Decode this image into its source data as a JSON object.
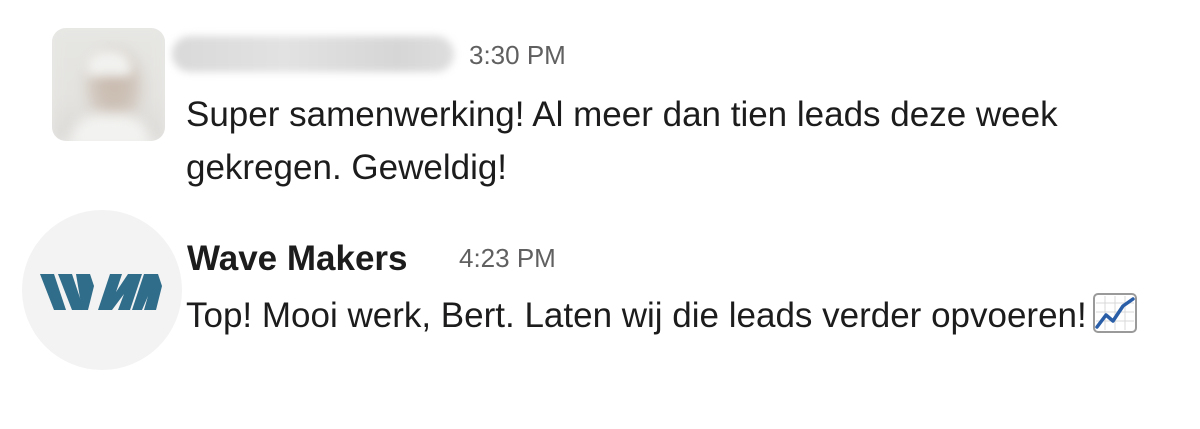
{
  "messages": [
    {
      "sender": "",
      "time": "3:30 PM",
      "text": "Super samenwerking! Al meer dan tien leads deze week gekregen. Geweldig!"
    },
    {
      "sender": "Wave Makers",
      "time": "4:23 PM",
      "text": "Top! Mooi werk, Bert. Laten wij die leads verder opvoeren!",
      "emoji": "chart-increasing-icon"
    }
  ],
  "colors": {
    "text": "#1d1c1d",
    "timestamp": "#616061",
    "logo_blue": "#2f6d8a",
    "avatar_bg": "#f3f3f3"
  }
}
